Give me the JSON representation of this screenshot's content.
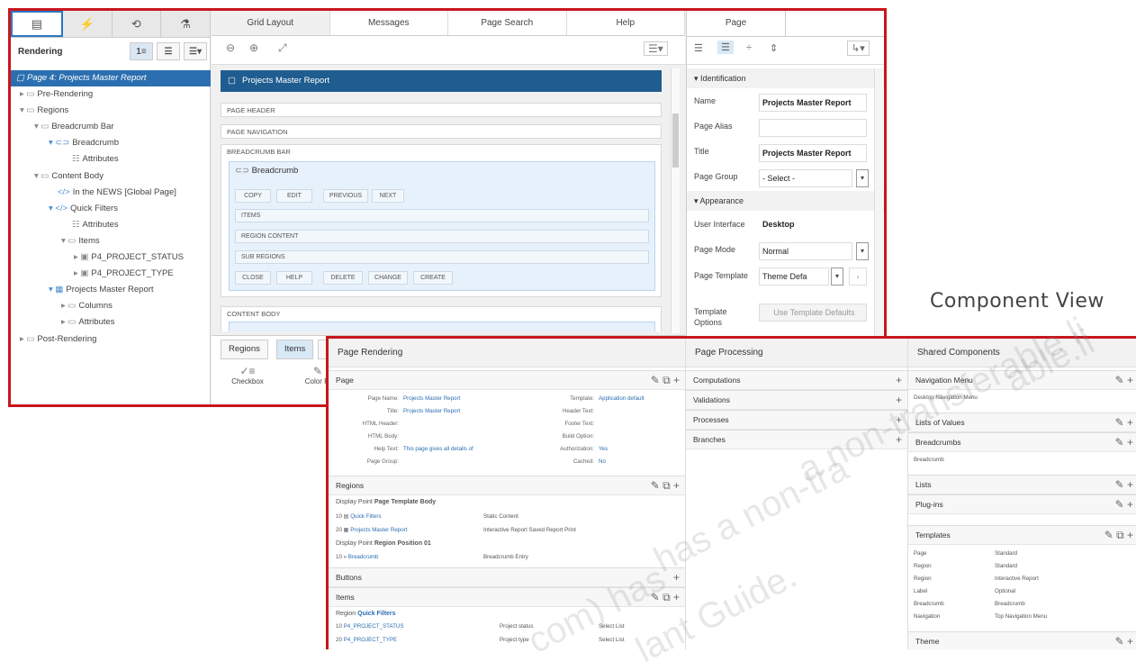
{
  "tree": {
    "title": "Rendering",
    "items": [
      "Page 4: Projects Master Report",
      "Pre-Rendering",
      "Regions",
      "Breadcrumb Bar",
      "Breadcrumb",
      "Attributes",
      "Content Body",
      "In the NEWS [Global Page]",
      "Quick Filters",
      "Attributes",
      "Items",
      "P4_PROJECT_STATUS",
      "P4_PROJECT_TYPE",
      "Projects Master Report",
      "Columns",
      "Attributes",
      "Post-Rendering"
    ]
  },
  "mid": {
    "tabs": [
      "Grid Layout",
      "Messages",
      "Page Search",
      "Help"
    ],
    "page_title": "Projects Master Report",
    "page_header": "PAGE HEADER",
    "page_navigation": "PAGE NAVIGATION",
    "breadcrumb_bar": "BREADCRUMB BAR",
    "breadcrumb": "Breadcrumb",
    "buttons_top": [
      "COPY",
      "EDIT",
      "PREVIOUS",
      "NEXT"
    ],
    "items": "ITEMS",
    "region_content": "REGION CONTENT",
    "sub_regions": "SUB REGIONS",
    "buttons_bottom": [
      "CLOSE",
      "HELP",
      "DELETE",
      "CHANGE",
      "CREATE"
    ],
    "content_body": "CONTENT BODY",
    "bottom_tabs": [
      "Regions",
      "Items",
      "B"
    ],
    "gallery": [
      "Checkbox",
      "Color Pi"
    ]
  },
  "props": {
    "tab": "Page",
    "sec_identification": "▾ Identification",
    "name_label": "Name",
    "name_value": "Projects Master Report",
    "alias_label": "Page Alias",
    "title_label": "Title",
    "title_value": "Projects Master Report",
    "group_label": "Page Group",
    "group_value": "- Select -",
    "sec_appearance": "▾ Appearance",
    "ui_label": "User Interface",
    "ui_value": "Desktop",
    "mode_label": "Page Mode",
    "mode_value": "Normal",
    "template_label": "Page Template",
    "template_value": "Theme Defa",
    "options_label": "Template Options",
    "options_button": "Use Template Defaults"
  },
  "component_view_label": "Component View",
  "cv": {
    "col1_header": "Page Rendering",
    "col2_header": "Page Processing",
    "col3_header": "Shared Components",
    "page_section": "Page",
    "page_left": [
      [
        "Page Name:",
        "Projects Master Report"
      ],
      [
        "Title:",
        "Projects Master Report"
      ],
      [
        "HTML Header:",
        ""
      ],
      [
        "HTML Body:",
        ""
      ],
      [
        "Help Text:",
        "This page gives all details of"
      ],
      [
        "Page Group:",
        ""
      ]
    ],
    "page_right": [
      [
        "Template:",
        "Application default"
      ],
      [
        "Header Text:",
        ""
      ],
      [
        "Footer Text:",
        ""
      ],
      [
        "Build Option:",
        ""
      ],
      [
        "Authorization:",
        "Yes"
      ],
      [
        "Cached:",
        "No"
      ]
    ],
    "regions_section": "Regions",
    "display_point_label": "Display Point",
    "dp1": "Page Template Body",
    "regions": [
      [
        "10",
        "Quick Filters",
        "Static Content"
      ],
      [
        "20",
        "Projects Master Report",
        "Interactive Report Saved Report Print"
      ]
    ],
    "dp2": "Region Position 01",
    "regions2": [
      [
        "10",
        "Breadcrumb",
        "Breadcrumb Entry"
      ]
    ],
    "buttons_section": "Buttons",
    "items_section": "Items",
    "region_label": "Region",
    "region_name": "Quick Filters",
    "items_rows": [
      [
        "10",
        "P4_PROJECT_STATUS",
        "Project status",
        "Select List"
      ],
      [
        "20",
        "P4_PROJECT_TYPE",
        "Project type",
        "Select List"
      ]
    ],
    "processing": [
      "Computations",
      "Validations",
      "Processes",
      "Branches"
    ],
    "nav_menu": "Navigation Menu",
    "nav_menu_link": "Desktop Navigation Menu",
    "lov": "Lists of Values",
    "breadcrumbs": "Breadcrumbs",
    "breadcrumbs_link": "Breadcrumb",
    "lists": "Lists",
    "plugins": "Plug-ins",
    "templates": "Templates",
    "templates_rows": [
      [
        "Page",
        "Standard"
      ],
      [
        "Region",
        "Standard"
      ],
      [
        "Region",
        "Interactive Report"
      ],
      [
        "Label",
        "Optional"
      ],
      [
        "Breadcrumb",
        "Breadcrumb"
      ],
      [
        "Navigation",
        "Top Navigation Menu"
      ]
    ],
    "theme": "Theme"
  },
  "watermark": [
    "able.li",
    "a non-transferable li",
    "has a non-tra",
    "com) has",
    "lant Guide."
  ]
}
